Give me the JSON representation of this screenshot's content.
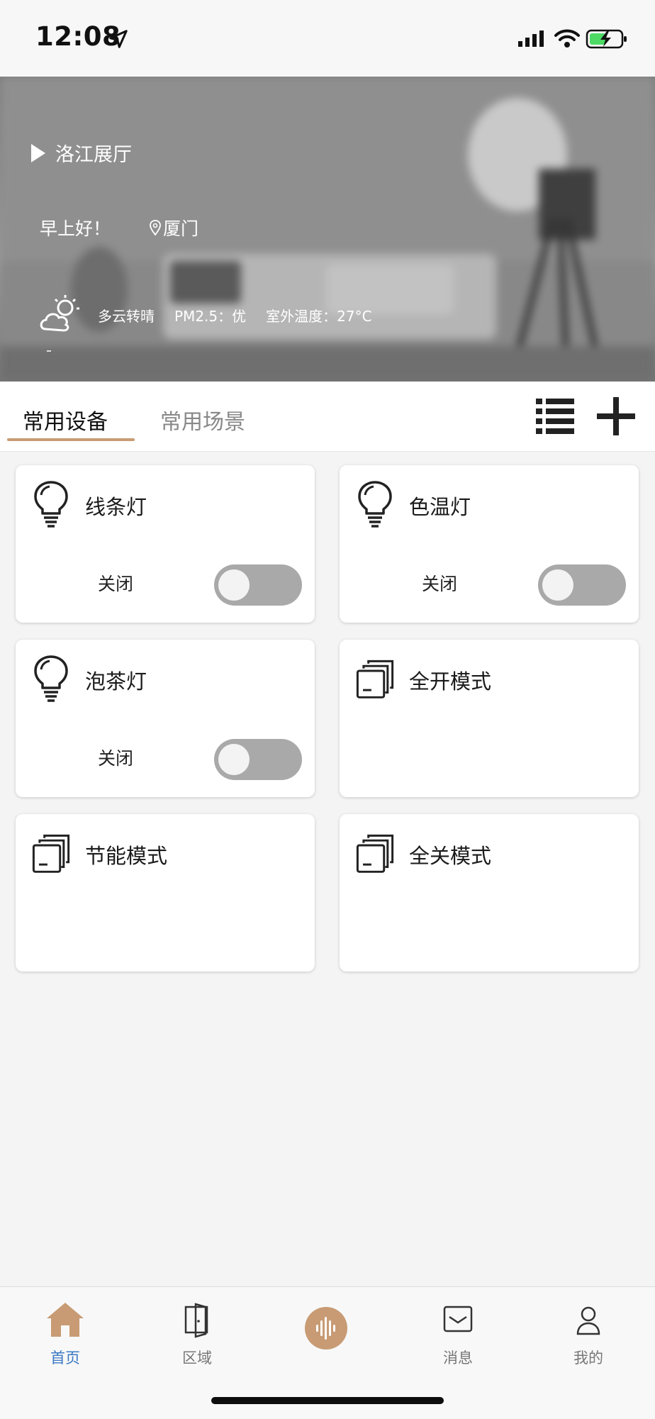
{
  "status_bar": {
    "time": "12:08"
  },
  "hero": {
    "project_name": "洛江展厅",
    "greeting": "早上好！",
    "city": "厦门",
    "weather": {
      "condition": "多云转晴",
      "pm25": "PM2.5：优",
      "outdoor_temp": "室外温度：27°C"
    }
  },
  "tabs": [
    {
      "label": "常用设备",
      "active": true
    },
    {
      "label": "常用场景",
      "active": false
    }
  ],
  "devices": [
    {
      "name": "线条灯",
      "icon": "bulb-icon",
      "status": "关闭",
      "on": false
    },
    {
      "name": "色温灯",
      "icon": "bulb-icon",
      "status": "关闭",
      "on": false
    },
    {
      "name": "泡茶灯",
      "icon": "bulb-icon",
      "status": "关闭",
      "on": false
    },
    {
      "name": "全开模式",
      "icon": "scene-icon"
    },
    {
      "name": "节能模式",
      "icon": "scene-icon"
    },
    {
      "name": "全关模式",
      "icon": "scene-icon"
    }
  ],
  "bottom_nav": [
    {
      "label": "首页",
      "icon": "home-icon",
      "active": true
    },
    {
      "label": "区域",
      "icon": "door-icon",
      "active": false
    },
    {
      "label": "",
      "icon": "voice-icon",
      "active": false
    },
    {
      "label": "消息",
      "icon": "message-icon",
      "active": false
    },
    {
      "label": "我的",
      "icon": "user-icon",
      "active": false
    }
  ],
  "colors": {
    "accent": "#c89b74",
    "active_nav": "#3b78c3",
    "toggle_off": "#a9a9a9"
  }
}
